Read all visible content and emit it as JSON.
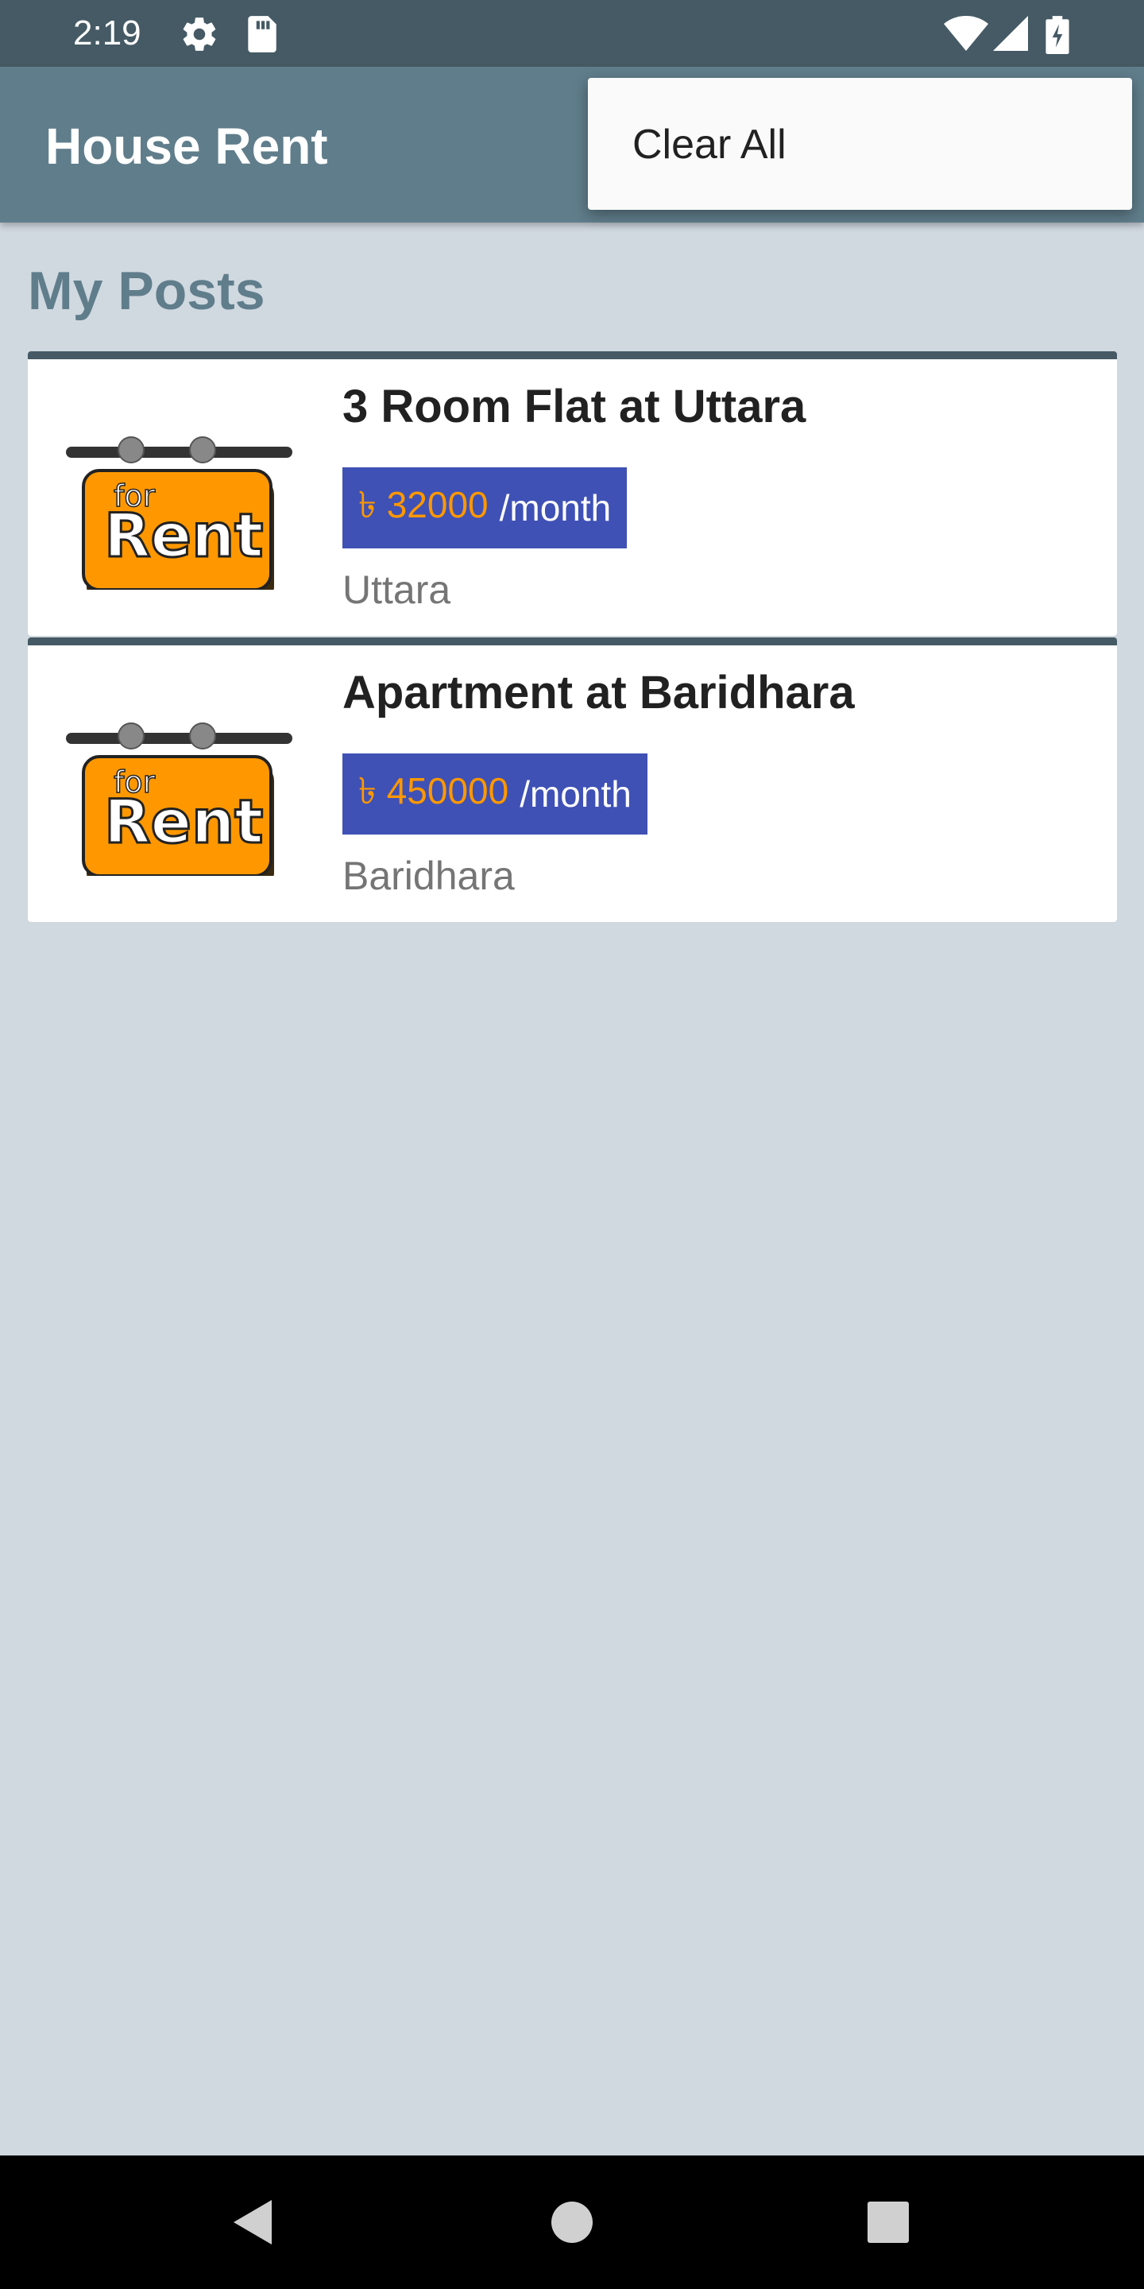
{
  "status_bar": {
    "time": "2:19",
    "icons": [
      "gear-icon",
      "sd-card-icon",
      "wifi-icon",
      "signal-icon",
      "battery-charging-icon"
    ]
  },
  "app_bar": {
    "title": "House Rent",
    "background": "#607d8b"
  },
  "overflow_menu": {
    "items": [
      {
        "label": "Clear All"
      }
    ]
  },
  "main": {
    "section_title": "My Posts",
    "posts": [
      {
        "title": "3 Room Flat at Uttara",
        "price": "৳ 32000",
        "unit": "/month",
        "location": "Uttara",
        "thumbnail_text": {
          "small": "for",
          "large": "Rent"
        }
      },
      {
        "title": "Apartment at Baridhara",
        "price": "৳ 450000",
        "unit": "/month",
        "location": "Baridhara",
        "thumbnail_text": {
          "small": "for",
          "large": "Rent"
        }
      }
    ]
  },
  "nav_bar": {
    "buttons": [
      "back-icon",
      "home-icon",
      "recents-icon"
    ]
  },
  "colors": {
    "primary": "#607d8b",
    "primary_dark": "#455a64",
    "price_badge": "#3f51b5",
    "price_text": "#ff9800",
    "background": "#d0d8e0"
  }
}
